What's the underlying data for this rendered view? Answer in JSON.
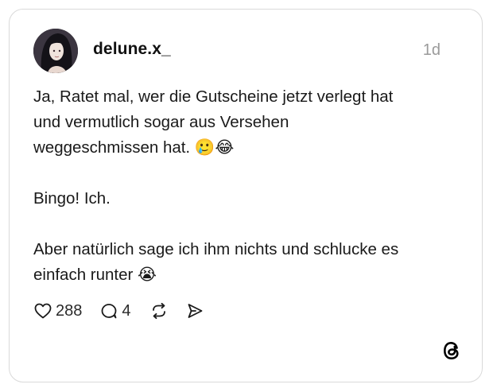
{
  "post": {
    "author": {
      "username": "delune.x_",
      "avatar": "profile-photo"
    },
    "timestamp": "1d",
    "paragraphs": [
      "Ja, Ratet mal, wer die Gutscheine jetzt verlegt hat\nund vermutlich sogar aus Versehen\nweggeschmissen hat. 🥲😂",
      "Bingo! Ich.",
      "Aber natürlich sage ich ihm nichts und schlucke es\neinfach runter 😭"
    ],
    "actions": {
      "like": {
        "icon": "heart-icon",
        "count": "288"
      },
      "reply": {
        "icon": "comment-icon",
        "count": "4"
      },
      "repost": {
        "icon": "repost-icon"
      },
      "share": {
        "icon": "send-icon"
      }
    }
  },
  "branding": {
    "logo": "threads-logo"
  }
}
